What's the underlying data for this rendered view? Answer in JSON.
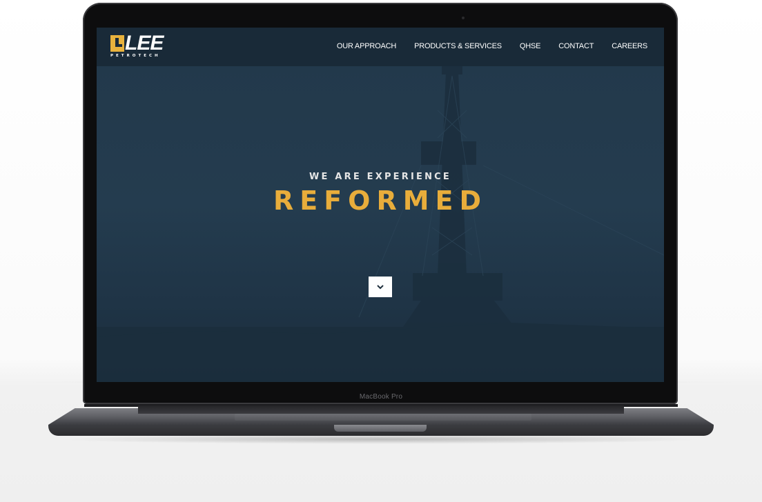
{
  "device": {
    "label": "MacBook Pro"
  },
  "site": {
    "logo": {
      "text": "LEE",
      "subtext": "PETROTECH"
    },
    "nav": [
      {
        "label": "OUR APPROACH"
      },
      {
        "label": "PRODUCTS & SERVICES"
      },
      {
        "label": "QHSE"
      },
      {
        "label": "CONTACT"
      },
      {
        "label": "CAREERS"
      }
    ],
    "hero": {
      "kicker": "WE ARE EXPERIENCE",
      "title": "REFORMED"
    },
    "scroll_button": {
      "icon": "chevron-down-icon"
    }
  },
  "colors": {
    "accent": "#e8ad3b",
    "header_bg": "#192a38",
    "hero_bg": "#22384a"
  }
}
